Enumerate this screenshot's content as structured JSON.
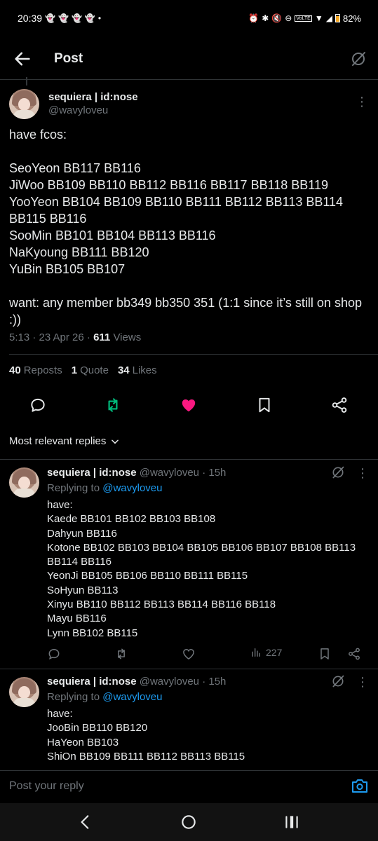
{
  "status_bar": {
    "time": "20:39",
    "battery": "82%",
    "network": "VoLTE"
  },
  "header": {
    "title": "Post"
  },
  "post": {
    "author_name": "sequiera | id:nose",
    "author_handle": "@wavyloveu",
    "text": "have fcos:\n\nSeoYeon BB117 BB116\nJiWoo BB109 BB110 BB112 BB116 BB117 BB118 BB119\nYooYeon BB104 BB109 BB110 BB111 BB112 BB113 BB114 BB115 BB116\nSooMin BB101 BB104 BB113 BB116\nNaKyoung BB111 BB120\nYuBin BB105 BB107\n\nwant: any member bb349 bb350 351 (1:1 since it’s still on shop :))",
    "timestamp": "5:13 · 23 Apr 26 · ",
    "views_count": "611",
    "views_label": "Views",
    "reposts_count": "40",
    "reposts_label": "Reposts",
    "quotes_count": "1",
    "quotes_label": "Quote",
    "likes_count": "34",
    "likes_label": "Likes"
  },
  "replies_sort": {
    "label": "Most relevant replies"
  },
  "replies": [
    {
      "author_name": "sequiera | id:nose",
      "author_handle": "@wavyloveu",
      "age": "· 15h",
      "replying_prefix": "Replying to ",
      "replying_to": "@wavyloveu",
      "text": "have:\nKaede BB101 BB102 BB103 BB108\nDahyun BB116\nKotone BB102 BB103 BB104 BB105 BB106 BB107 BB108 BB113 BB114 BB116\nYeonJi BB105 BB106 BB110 BB111 BB115\nSoHyun BB113\nXinyu BB110 BB112 BB113 BB114 BB116 BB118\nMayu BB116\nLynn BB102 BB115",
      "views": "227"
    },
    {
      "author_name": "sequiera | id:nose",
      "author_handle": "@wavyloveu",
      "age": "· 15h",
      "replying_prefix": "Replying to ",
      "replying_to": "@wavyloveu",
      "text": "have:\nJooBin BB110 BB120\nHaYeon BB103\nShiOn BB109 BB111 BB112 BB113 BB115"
    }
  ],
  "compose": {
    "placeholder": "Post your reply"
  },
  "colors": {
    "accent": "#1d9bf0",
    "like": "#f91880",
    "repost": "#00ba7c",
    "muted": "#71767b"
  }
}
